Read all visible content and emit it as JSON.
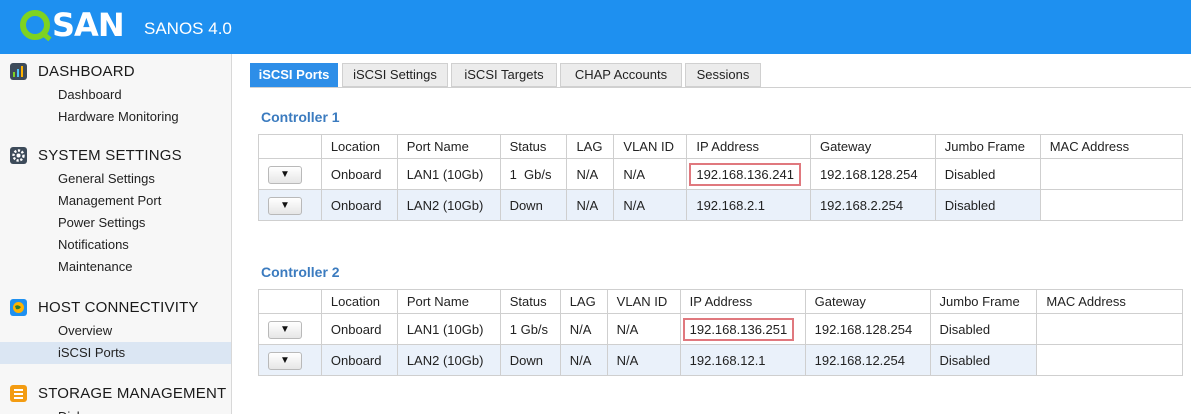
{
  "header": {
    "brand": "SAN",
    "product": "SANOS 4.0"
  },
  "sidebar": {
    "sections": [
      {
        "title": "DASHBOARD",
        "icon": "dashboard-chart-icon",
        "items": [
          "Dashboard",
          "Hardware Monitoring"
        ]
      },
      {
        "title": "SYSTEM SETTINGS",
        "icon": "settings-gear-icon",
        "items": [
          "General Settings",
          "Management Port",
          "Power Settings",
          "Notifications",
          "Maintenance"
        ]
      },
      {
        "title": "HOST CONNECTIVITY",
        "icon": "globe-icon",
        "items": [
          "Overview",
          "iSCSI Ports"
        ],
        "active": "iSCSI Ports"
      },
      {
        "title": "STORAGE MANAGEMENT",
        "icon": "storage-stack-icon",
        "items": [
          "Disks"
        ]
      }
    ]
  },
  "tabs": [
    "iSCSI Ports",
    "iSCSI Settings",
    "iSCSI Targets",
    "CHAP Accounts",
    "Sessions"
  ],
  "active_tab": "iSCSI Ports",
  "columns": [
    "",
    "Location",
    "Port Name",
    "Status",
    "LAG",
    "VLAN ID",
    "IP Address",
    "Gateway",
    "Jumbo Frame",
    "MAC Address"
  ],
  "dropdown_glyph": "▼",
  "controllers": [
    {
      "title": "Controller 1",
      "rows": [
        {
          "location": "Onboard",
          "port": "LAN1 (10Gb)",
          "status": "1  Gb/s",
          "lag": "N/A",
          "vlan": "N/A",
          "ip": "192.168.136.241",
          "gateway": "192.168.128.254",
          "jumbo": "Disabled",
          "mac": ""
        },
        {
          "location": "Onboard",
          "port": "LAN2 (10Gb)",
          "status": "Down",
          "lag": "N/A",
          "vlan": "N/A",
          "ip": "192.168.2.1",
          "gateway": "192.168.2.254",
          "jumbo": "Disabled",
          "mac": ""
        }
      ]
    },
    {
      "title": "Controller 2",
      "rows": [
        {
          "location": "Onboard",
          "port": "LAN1 (10Gb)",
          "status": "1 Gb/s",
          "lag": "N/A",
          "vlan": "N/A",
          "ip": "192.168.136.251",
          "gateway": "192.168.128.254",
          "jumbo": "Disabled",
          "mac": ""
        },
        {
          "location": "Onboard",
          "port": "LAN2 (10Gb)",
          "status": "Down",
          "lag": "N/A",
          "vlan": "N/A",
          "ip": "192.168.12.1",
          "gateway": "192.168.12.254",
          "jumbo": "Disabled",
          "mac": ""
        }
      ]
    }
  ],
  "highlight_color": "#e0787e"
}
